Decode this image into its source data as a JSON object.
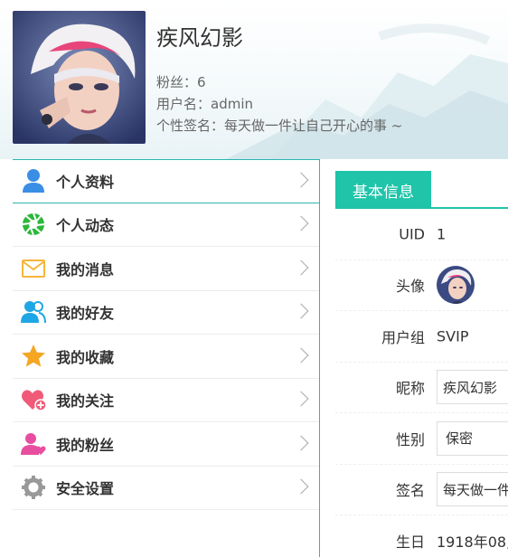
{
  "profile": {
    "nickname": "疾风幻影",
    "fans": "粉丝：6",
    "username": "用户名：admin",
    "signature": "个性签名：每天做一件让自己开心的事 ~"
  },
  "sidebar": {
    "items": [
      {
        "label": "个人资料",
        "icon": "user-icon",
        "color": "#3a8ee6"
      },
      {
        "label": "个人动态",
        "icon": "aperture-icon",
        "color": "#2cb83a"
      },
      {
        "label": "我的消息",
        "icon": "mail-icon",
        "color": "#f5b63b"
      },
      {
        "label": "我的好友",
        "icon": "friends-icon",
        "color": "#1fa6e6"
      },
      {
        "label": "我的收藏",
        "icon": "star-icon",
        "color": "#f5a623"
      },
      {
        "label": "我的关注",
        "icon": "heart-plus-icon",
        "color": "#f05a78"
      },
      {
        "label": "我的粉丝",
        "icon": "user-heart-icon",
        "color": "#e84ea0"
      },
      {
        "label": "安全设置",
        "icon": "gear-icon",
        "color": "#999999"
      }
    ]
  },
  "panel": {
    "tab": "基本信息",
    "rows": [
      {
        "label": "UID",
        "value": "1"
      },
      {
        "label": "头像"
      },
      {
        "label": "用户组",
        "value": "SVIP"
      },
      {
        "label": "昵称",
        "value": "疾风幻影"
      },
      {
        "label": "性别",
        "value": "保密"
      },
      {
        "label": "签名",
        "value": "每天做一件"
      },
      {
        "label": "生日",
        "value": "1918年08,"
      }
    ]
  },
  "colors": {
    "accent": "#1fc4a9",
    "border": "#2bb6b0"
  }
}
